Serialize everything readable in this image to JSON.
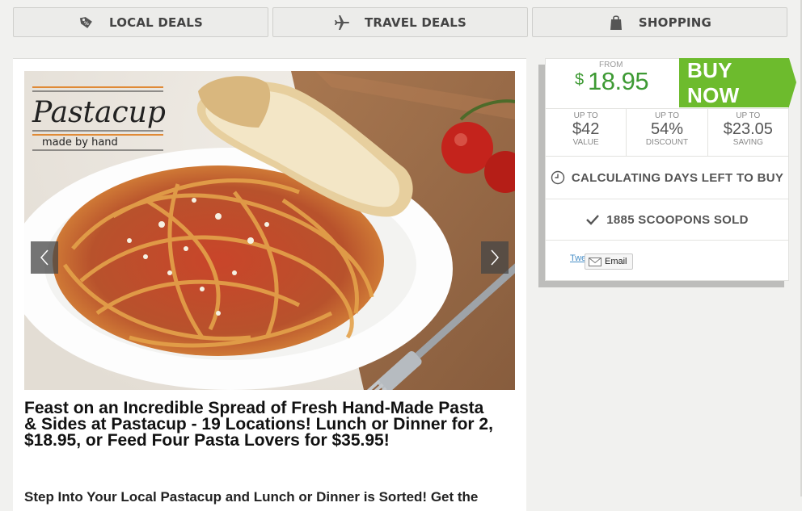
{
  "categories": [
    {
      "label": "LOCAL DEALS",
      "icon": "tag-icon"
    },
    {
      "label": "TRAVEL DEALS",
      "icon": "airplane-icon"
    },
    {
      "label": "SHOPPING",
      "icon": "shopping-bag-icon"
    }
  ],
  "hero": {
    "logo_text": "Pastacup",
    "logo_tagline": "made by hand",
    "image": "plate of spaghetti with meat sauce and parmesan, bread slices, cherry tomatoes, fork"
  },
  "deal": {
    "title": "Feast on an Incredible Spread of Fresh Hand-Made Pasta & Sides at Pastacup - 19 Locations! Lunch or Dinner for 2, $18.95, or Feed Four Pasta Lovers for $35.95!",
    "intro": "Step Into Your Local Pastacup and Lunch or Dinner is Sorted! Get the"
  },
  "sidebar": {
    "from_label": "FROM",
    "currency": "$",
    "price": "18.95",
    "buy_label": "BUY NOW",
    "stats": [
      {
        "up": "UP TO",
        "value": "$42",
        "caption": "VALUE"
      },
      {
        "up": "UP TO",
        "value": "54%",
        "caption": "DISCOUNT"
      },
      {
        "up": "UP TO",
        "value": "$23.05",
        "caption": "SAVING"
      }
    ],
    "days_left": "CALCULATING DAYS LEFT TO BUY",
    "sold": "1885 SCOOPONS SOLD",
    "tweet": "Twe",
    "email": "Email"
  },
  "colors": {
    "accent_green": "#6dbb2d",
    "price_green": "#3e9a34"
  }
}
